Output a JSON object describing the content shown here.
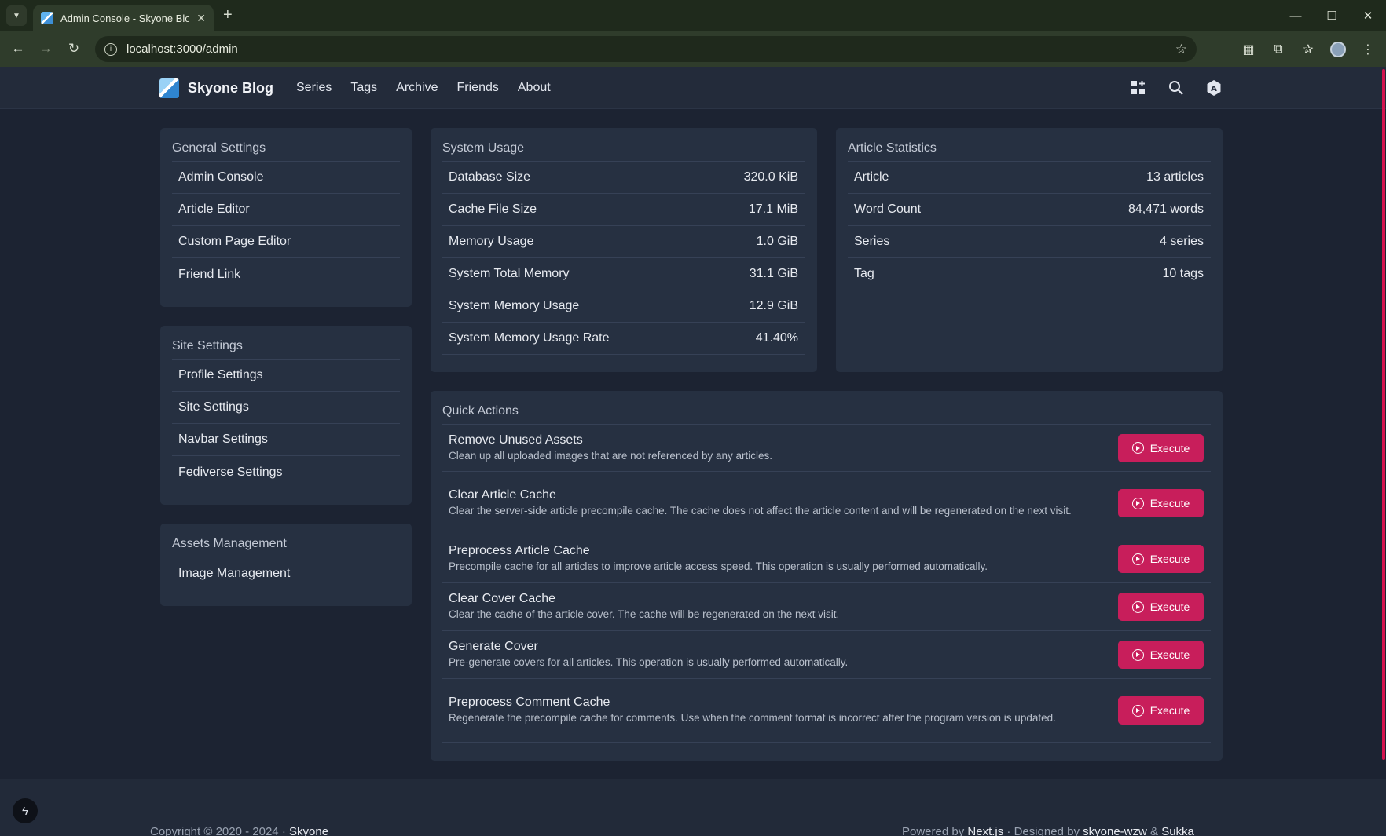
{
  "browser": {
    "tab_title": "Admin Console - Skyone Blog",
    "url": "localhost:3000/admin"
  },
  "site": {
    "brand": "Skyone Blog",
    "nav": [
      "Series",
      "Tags",
      "Archive",
      "Friends",
      "About"
    ]
  },
  "general_settings": {
    "title": "General Settings",
    "items": [
      "Admin Console",
      "Article Editor",
      "Custom Page Editor",
      "Friend Link"
    ]
  },
  "site_settings": {
    "title": "Site Settings",
    "items": [
      "Profile Settings",
      "Site Settings",
      "Navbar Settings",
      "Fediverse Settings"
    ]
  },
  "assets_management": {
    "title": "Assets Management",
    "items": [
      "Image Management"
    ]
  },
  "system_usage": {
    "title": "System Usage",
    "rows": [
      {
        "label": "Database Size",
        "value": "320.0 KiB"
      },
      {
        "label": "Cache File Size",
        "value": "17.1 MiB"
      },
      {
        "label": "Memory Usage",
        "value": "1.0 GiB"
      },
      {
        "label": "System Total Memory",
        "value": "31.1 GiB"
      },
      {
        "label": "System Memory Usage",
        "value": "12.9 GiB"
      },
      {
        "label": "System Memory Usage Rate",
        "value": "41.40%"
      }
    ]
  },
  "article_statistics": {
    "title": "Article Statistics",
    "rows": [
      {
        "label": "Article",
        "value": "13 articles"
      },
      {
        "label": "Word Count",
        "value": "84,471 words"
      },
      {
        "label": "Series",
        "value": "4 series"
      },
      {
        "label": "Tag",
        "value": "10 tags"
      }
    ]
  },
  "quick_actions": {
    "title": "Quick Actions",
    "button_label": "Execute",
    "actions": [
      {
        "name": "Remove Unused Assets",
        "description": "Clean up all uploaded images that are not referenced by any articles."
      },
      {
        "name": "Clear Article Cache",
        "description": "Clear the server-side article precompile cache. The cache does not affect the article content and will be regenerated on the next visit."
      },
      {
        "name": "Preprocess Article Cache",
        "description": "Precompile cache for all articles to improve article access speed. This operation is usually performed automatically."
      },
      {
        "name": "Clear Cover Cache",
        "description": "Clear the cache of the article cover. The cache will be regenerated on the next visit."
      },
      {
        "name": "Generate Cover",
        "description": "Pre-generate covers for all articles. This operation is usually performed automatically."
      },
      {
        "name": "Preprocess Comment Cache",
        "description": "Regenerate the precompile cache for comments. Use when the comment format is incorrect after the program version is updated."
      }
    ]
  },
  "footer": {
    "copyright": "Copyright © 2020 - 2024 ·",
    "owner": "Skyone",
    "powered_by": "Powered by",
    "framework": "Next.js",
    "designed_by": "· Designed by",
    "designer1": "skyone-wzw",
    "and": "&",
    "designer2": "Sukka"
  },
  "colors": {
    "accent": "#c81e5b",
    "background": "#1c2332",
    "card": "#263041"
  }
}
